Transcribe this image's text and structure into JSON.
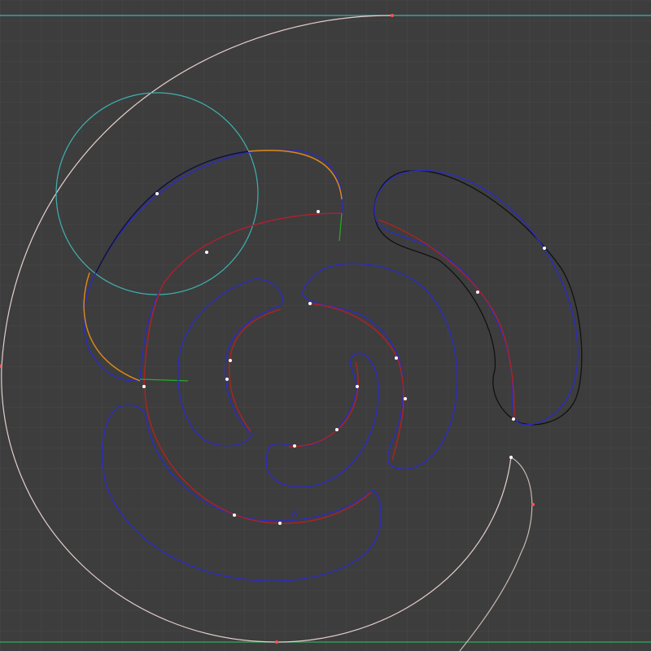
{
  "viewport": {
    "background": "#3d3d3d",
    "grid_minor_color": "#484848",
    "grid_major_color": "#444444"
  },
  "colors": {
    "guide_circle": "#e6cdcd",
    "inner_circle": "#3fb0b0",
    "horizon_top": "#3fb0b0",
    "horizon_bottom": "#2db05a",
    "outline_blue": "#2c2cc0",
    "outline_dark": "#101040",
    "spine_red": "#b02222",
    "spine_orange": "#e08a1a",
    "curve_black": "#111111",
    "handle_green": "#22b022",
    "point_white": "#ffffff",
    "point_red": "#ff5050"
  },
  "objects": [
    {
      "name": "outer-guide-arc",
      "kind": "spiral-curve"
    },
    {
      "name": "small-guide-circle",
      "kind": "circle"
    },
    {
      "name": "upper-left-blade",
      "kind": "bezier-outline"
    },
    {
      "name": "right-blade",
      "kind": "bezier-outline"
    },
    {
      "name": "middle-ring-blade",
      "kind": "bezier-outline"
    },
    {
      "name": "bottom-blade",
      "kind": "bezier-outline"
    },
    {
      "name": "inner-left-blade",
      "kind": "bezier-outline"
    },
    {
      "name": "inner-right-blade",
      "kind": "bezier-outline"
    },
    {
      "name": "center-blade",
      "kind": "bezier-outline"
    }
  ]
}
